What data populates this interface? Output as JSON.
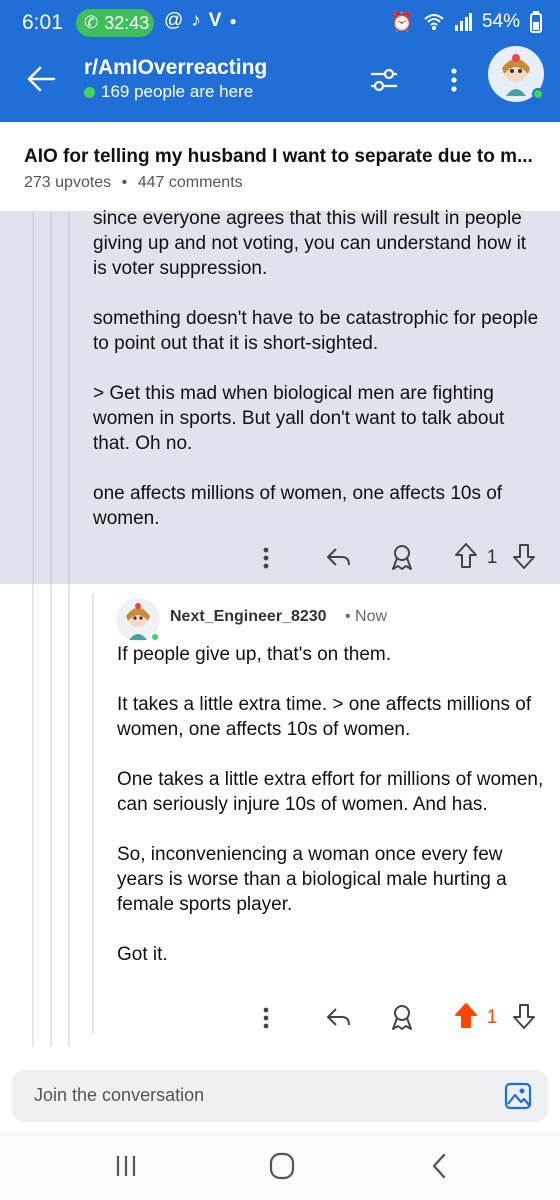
{
  "status_bar": {
    "time": "6:01",
    "call_duration": "32:43",
    "battery": "54%",
    "app_icons": [
      "threads-icon",
      "tiktok-icon",
      "v-icon",
      "dot-icon"
    ],
    "right_icons": [
      "alarm-icon",
      "wifi-icon",
      "signal-icon"
    ]
  },
  "header": {
    "subreddit": "r/AmIOverreacting",
    "online_text": "169 people are here"
  },
  "post": {
    "title": "AIO for telling my husband I want to separate due to m...",
    "upvotes": "273 upvotes",
    "separator": "•",
    "comments": "447 comments"
  },
  "comment1": {
    "paragraphs": [
      "since everyone agrees that this will result in people giving up and not voting, you can understand how it is voter suppression.",
      "something doesn't have to be catastrophic for people to point out that it is short-sighted.",
      "> Get this mad when biological men are fighting women in sports. But yall don't want to talk about that. Oh no.",
      "one affects millions of women, one affects 10s of women."
    ],
    "vote_count": "1"
  },
  "comment2": {
    "username": "Next_Engineer_8230",
    "time": "• Now",
    "paragraphs": [
      "If people give up, that's on them.",
      "It takes a little extra time. > one affects millions of women, one affects 10s of women.",
      "One takes a little extra effort for millions of women,  can seriously injure 10s of women. And has.",
      "So, inconveniencing a woman once every few years is worse than a biological male hurting a female sports player.",
      "Got it."
    ],
    "vote_count": "1"
  },
  "composer": {
    "placeholder": "Join the conversation"
  },
  "colors": {
    "brand_blue": "#1f6fd6",
    "upvote_active": "#ff4500",
    "highlight_bg": "#dfe3eb"
  }
}
